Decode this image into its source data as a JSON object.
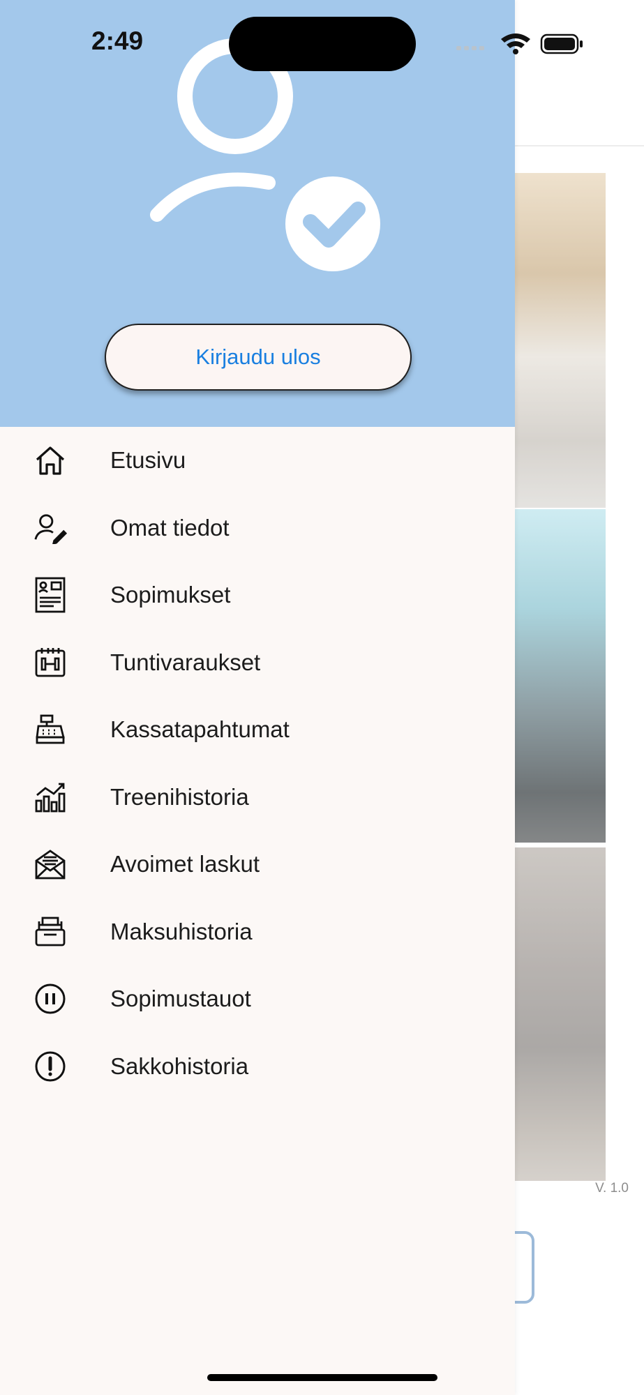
{
  "status_bar": {
    "time": "2:49"
  },
  "drawer": {
    "logout_label": "Kirjaudu ulos",
    "menu": [
      {
        "label": "Etusivu",
        "icon": "home-icon"
      },
      {
        "label": "Omat tiedot",
        "icon": "user-edit-icon"
      },
      {
        "label": "Sopimukset",
        "icon": "contract-icon"
      },
      {
        "label": "Tuntivaraukset",
        "icon": "calendar-dumbbell-icon"
      },
      {
        "label": "Kassatapahtumat",
        "icon": "cash-register-icon"
      },
      {
        "label": "Treenihistoria",
        "icon": "chart-icon"
      },
      {
        "label": "Avoimet laskut",
        "icon": "envelope-invoice-icon"
      },
      {
        "label": "Maksuhistoria",
        "icon": "archive-tray-icon"
      },
      {
        "label": "Sopimustauot",
        "icon": "pause-icon"
      },
      {
        "label": "Sakkohistoria",
        "icon": "exclamation-icon"
      }
    ]
  },
  "background": {
    "version": "V. 1.0"
  },
  "colors": {
    "header": "#a3c8eb",
    "link": "#1a7fe0",
    "drawer_bg": "#fcf8f6"
  }
}
